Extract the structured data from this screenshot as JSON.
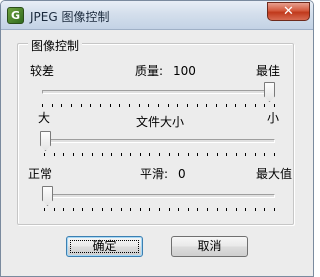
{
  "window": {
    "title": "JPEG 图像控制",
    "close_glyph": "✕",
    "icon": "app-g-icon"
  },
  "group": {
    "title": "图像控制"
  },
  "quality": {
    "min_label": "较差",
    "max_label": "最佳",
    "label": "质量:",
    "value": "100",
    "fraction": 1.0
  },
  "filesize": {
    "min_label": "大",
    "max_label": "小",
    "label": "文件大小",
    "fraction": 0.0
  },
  "smoothing": {
    "min_label": "正常",
    "max_label": "最大值",
    "label": "平滑:",
    "value": "0",
    "fraction": 0.0
  },
  "buttons": {
    "ok_label": "确定",
    "cancel_label": "取消"
  }
}
